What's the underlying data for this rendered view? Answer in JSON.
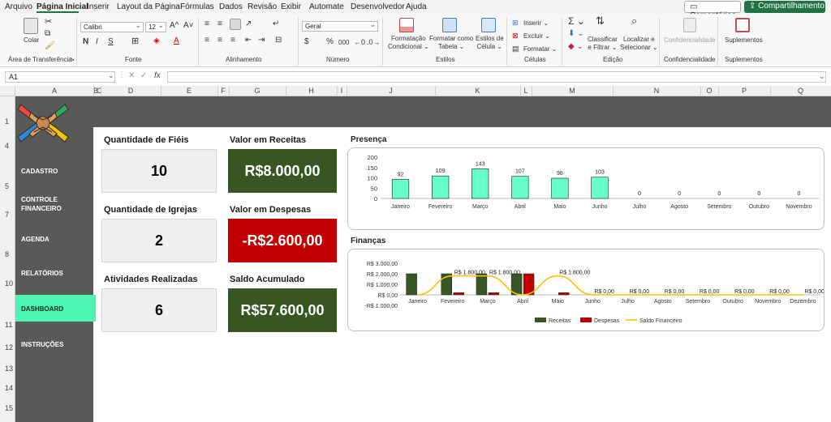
{
  "menu": {
    "items": [
      "Arquivo",
      "Página Inicial",
      "Inserir",
      "Layout da Página",
      "Fórmulas",
      "Dados",
      "Revisão",
      "Exibir",
      "Automate",
      "Desenvolvedor",
      "Ajuda"
    ],
    "comments": "Comentários",
    "share": "Compartilhamento"
  },
  "ribbon": {
    "paste": "Colar",
    "font_name": "Calibri",
    "font_size": "12",
    "bold": "N",
    "italic": "I",
    "underline": "S",
    "grow_font": "A^",
    "shrink_font": "A˅",
    "number_format": "Geral",
    "currency": "$",
    "percent": "%",
    "thousands": "000",
    "cond_format": [
      "Formatação",
      "Condicional ⌄"
    ],
    "format_table": [
      "Formatar como",
      "Tabela ⌄"
    ],
    "cell_styles": [
      "Estilos de",
      "Célula ⌄"
    ],
    "insert": "Inserir ⌄",
    "delete": "Excluir ⌄",
    "format": "Formatar ⌄",
    "sort": [
      "Classificar",
      "e Filtrar ⌄"
    ],
    "find": [
      "Localizar e",
      "Selecionar ⌄"
    ],
    "sensitivity": "Confidencialidade",
    "addins": "Suplementos",
    "groups": [
      "Área de Transferência",
      "Fonte",
      "Alinhamento",
      "Número",
      "Estilos",
      "Células",
      "Edição",
      "Confidencialidade",
      "Suplementos"
    ]
  },
  "formula": {
    "name_box": "A1",
    "fx": "fx",
    "value": ""
  },
  "columns": [
    "A",
    "B",
    "C",
    "D",
    "E",
    "F",
    "G",
    "H",
    "I",
    "J",
    "K",
    "L",
    "M",
    "N",
    "O",
    "P",
    "Q"
  ],
  "rows": [
    "1",
    "4",
    "5",
    "7",
    "8",
    "10",
    "11",
    "12",
    "13",
    "14",
    "15"
  ],
  "nav": {
    "items": [
      {
        "label": "CADASTRO"
      },
      {
        "label": "CONTROLE\nFINANCEIRO"
      },
      {
        "label": "AGENDA"
      },
      {
        "label": "RELATÓRIOS"
      },
      {
        "label": "DASHBOARD"
      },
      {
        "label": "INSTRUÇÕES"
      }
    ],
    "active": "DASHBOARD"
  },
  "cards": {
    "fieis_title": "Quantidade de Fiéis",
    "fieis_value": "10",
    "igrejas_title": "Quantidade de Igrejas",
    "igrejas_value": "2",
    "atividades_title": "Atividades Realizadas",
    "atividades_value": "6",
    "receitas_title": "Valor em Receitas",
    "receitas_value": "R$8.000,00",
    "despesas_title": "Valor em Despesas",
    "despesas_value": "-R$2.600,00",
    "saldo_title": "Saldo Acumulado",
    "saldo_value": "R$57.600,00"
  },
  "colors": {
    "green": "#375623",
    "red": "#C00000",
    "mint": "#66FFCC",
    "sheet_dark": "#595959",
    "accent": "#217346"
  },
  "chart_data": [
    {
      "type": "bar",
      "title": "Presença",
      "categories": [
        "Janeiro",
        "Fevereiro",
        "Março",
        "Abril",
        "Maio",
        "Junho",
        "Julho",
        "Agosto",
        "Setembro",
        "Outubro",
        "Novembro"
      ],
      "values": [
        92,
        109,
        143,
        107,
        98,
        103,
        0,
        0,
        0,
        0,
        0
      ],
      "ylim": [
        0,
        200
      ],
      "yticks": [
        0,
        50,
        100,
        150,
        200
      ],
      "color": "#66FFCC",
      "grid": false
    },
    {
      "type": "bar",
      "title": "Finanças",
      "categories": [
        "Janeiro",
        "Fevereiro",
        "Março",
        "Abril",
        "Maio",
        "Junho",
        "Julho",
        "Agosto",
        "Setembro",
        "Outubro",
        "Novembro",
        "Dezembro"
      ],
      "series": [
        {
          "name": "Receitas",
          "type": "bar",
          "color": "#375623",
          "values": [
            2000,
            2000,
            2000,
            2000,
            0,
            0,
            0,
            0,
            0,
            0,
            0,
            0
          ]
        },
        {
          "name": "Despesas",
          "type": "bar",
          "color": "#C00000",
          "values": [
            0,
            200,
            200,
            2000,
            200,
            0,
            0,
            0,
            0,
            0,
            0,
            0
          ]
        },
        {
          "name": "Saldo Financeiro",
          "type": "line",
          "color": "#FFC000",
          "values": [
            0,
            1800,
            1800,
            0,
            1800,
            0,
            0,
            0,
            0,
            0,
            0,
            0
          ],
          "labels": [
            "",
            "R$ 1.800,00",
            "R$ 1.800,00",
            "",
            "R$ 1.800,00",
            "R$ 0,00",
            "R$ 0,00",
            "R$ 0,00",
            "R$ 0,00",
            "R$ 0,00",
            "R$ 0,00",
            "R$ 0,00"
          ]
        }
      ],
      "ylim": [
        -1000,
        3000
      ],
      "yticks": [
        "-R$ 1.000,00",
        "R$ 0,00",
        "R$ 1.000,00",
        "R$ 2.000,00",
        "R$ 3.000,00"
      ],
      "legend": "bottom"
    }
  ]
}
